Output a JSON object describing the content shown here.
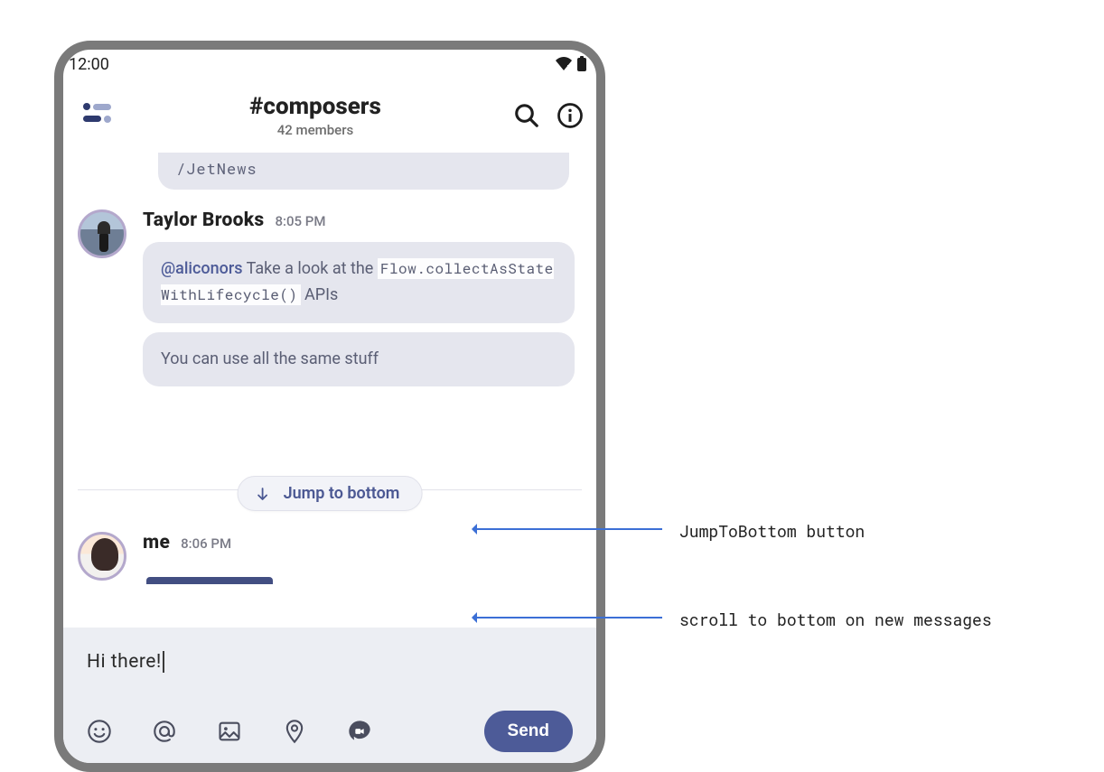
{
  "status": {
    "time": "12:00"
  },
  "header": {
    "channel": "#composers",
    "members": "42 members"
  },
  "chat": {
    "partial_msg": "/JetNews",
    "m1": {
      "name": "Taylor Brooks",
      "time": "8:05 PM",
      "b1_mention": "@aliconors",
      "b1_text1": " Take a look at the ",
      "b1_code": "Flow.collectAsStateWithLifecycle()",
      "b1_text2": " APIs",
      "b2": "You can use all the same stuff"
    },
    "jump_label": "Jump to bottom",
    "m2": {
      "name": "me",
      "time": "8:06 PM"
    }
  },
  "composer": {
    "text": "Hi there!",
    "send": "Send"
  },
  "annotations": {
    "jump": "JumpToBottom button",
    "scroll": "scroll to bottom on new messages"
  }
}
